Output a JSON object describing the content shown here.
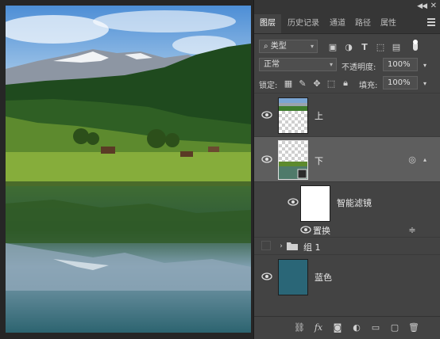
{
  "panel": {
    "tabs": [
      "图层",
      "历史记录",
      "通道",
      "路径",
      "属性"
    ],
    "active_tab": "图层",
    "filter": {
      "label": "类型",
      "icon": "search-icon"
    },
    "blend_mode": "正常",
    "opacity_label": "不透明度:",
    "opacity_value": "100%",
    "lock_label": "锁定:",
    "fill_label": "填充:",
    "fill_value": "100%"
  },
  "layers": [
    {
      "name": "上",
      "visible": true,
      "thumb": "landscape-top"
    },
    {
      "name": "下",
      "visible": true,
      "thumb": "landscape-bottom",
      "selected": true
    },
    {
      "name": "智能滤镜",
      "visible": true,
      "thumb": "white-mask"
    },
    {
      "name": "置换",
      "visible": true
    },
    {
      "name": "组 1",
      "visible": false,
      "type": "group"
    },
    {
      "name": "蓝色",
      "visible": true,
      "fill": "#2a6677"
    }
  ],
  "colors": {
    "panel_bg": "#434343",
    "selected_row": "#5e5e5e",
    "blue_layer": "#2a6677"
  }
}
